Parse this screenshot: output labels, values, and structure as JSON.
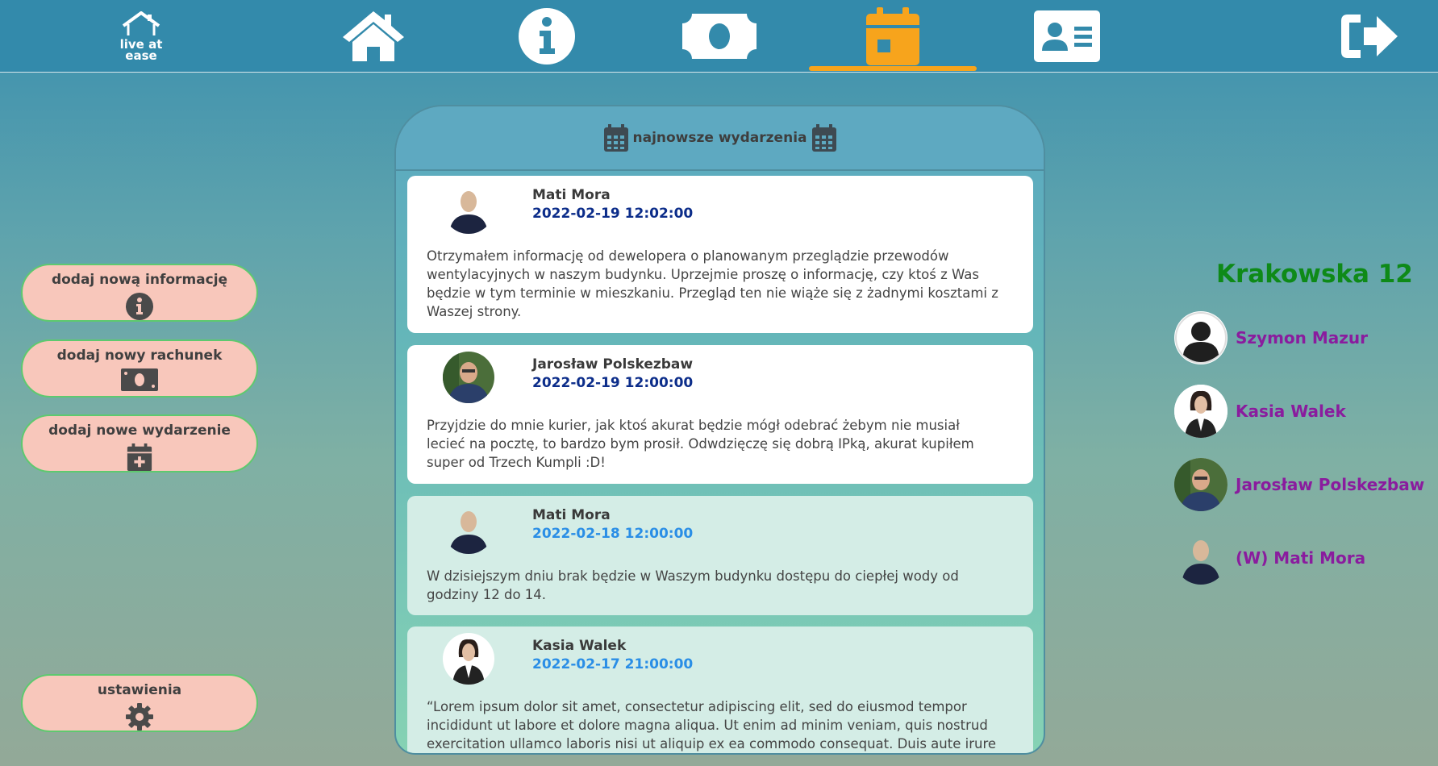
{
  "nav": {
    "logo_line1": "live at",
    "logo_line2": "ease",
    "items": [
      "home-icon",
      "info-icon",
      "money-icon",
      "calendar-icon",
      "contacts-icon",
      "logout-icon"
    ],
    "active": "calendar-icon",
    "accent": "#f7a41c"
  },
  "sidebar": {
    "buttons": [
      {
        "label": "dodaj nową informację",
        "icon": "info-icon"
      },
      {
        "label": "dodaj nowy rachunek",
        "icon": "money-icon"
      },
      {
        "label": "dodaj nowe wydarzenie",
        "icon": "calendar-plus-icon"
      }
    ],
    "settings_label": "ustawienia",
    "settings_icon": "gear-icon"
  },
  "feed": {
    "title": "najnowsze wydarzenia",
    "posts": [
      {
        "author": "Mati Mora",
        "date": "2022-02-19 12:02:00",
        "body": "Otrzymałem informację od dewelopera o planowanym przeglądzie przewodów wentylacyjnych w naszym budynku. Uprzejmie proszę o informację, czy ktoś z Was będzie w tym terminie w mieszkaniu. Przegląd ten nie wiąże się z żadnymi kosztami z Waszej strony."
      },
      {
        "author": "Jarosław Polskezbaw",
        "date": "2022-02-19 12:00:00",
        "body": "Przyjdzie do mnie kurier, jak ktoś akurat będzie mógł odebrać żebym nie musiał lecieć na pocztę, to bardzo bym prosił. Odwdzięczę się dobrą IPką, akurat kupiłem super od Trzech Kumpli :D!"
      },
      {
        "author": "Mati Mora",
        "date": "2022-02-18 12:00:00",
        "body": "W dzisiejszym dniu brak będzie w Waszym budynku dostępu do ciepłej wody od godziny 12 do 14."
      },
      {
        "author": "Kasia Walek",
        "date": "2022-02-17 21:00:00",
        "body": "“Lorem ipsum dolor sit amet, consectetur adipiscing elit, sed do eiusmod tempor incididunt ut labore et dolore magna aliqua. Ut enim ad minim veniam, quis nostrud exercitation ullamco laboris nisi ut aliquip ex ea commodo consequat. Duis aute irure"
      }
    ]
  },
  "building": {
    "address": "Krakowska 12",
    "residents": [
      {
        "name": "Szymon Mazur"
      },
      {
        "name": "Kasia Walek"
      },
      {
        "name": "Jarosław Polskezbaw"
      },
      {
        "name": "(W) Mati Mora"
      }
    ]
  }
}
